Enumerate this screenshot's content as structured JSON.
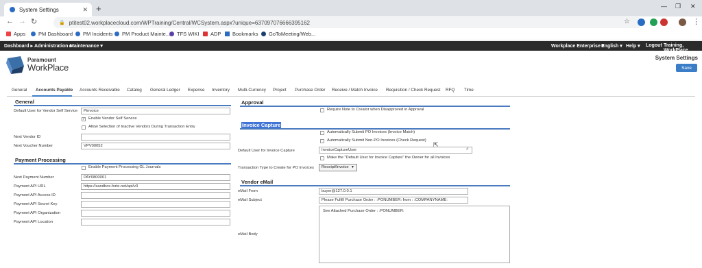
{
  "browser": {
    "tab_title": "System Settings",
    "url": "ptitest02.workplacecloud.com/WPTraining/Central/WCSystem.aspx?unique=637097076666395162"
  },
  "bookmarks": [
    "Apps",
    "PM Dashboard",
    "PM Incidents",
    "PM Product Mainte...",
    "TFS WIKI",
    "ADP",
    "Bookmarks",
    "GoToMeeting/Web..."
  ],
  "appnav": {
    "left": [
      "Dashboard ▸",
      "Administration ▸",
      "Maintenance ▾"
    ],
    "right": [
      "Workplace Enterprise ▾",
      "English ▾",
      "Help ▾",
      "Logout",
      "Training, WorkPlace"
    ]
  },
  "header": {
    "logo_line1": "Paramount",
    "logo_line2": "WorkPlace",
    "page_title": "System Settings",
    "save_label": "Save"
  },
  "tabs": [
    "General",
    "Accounts Payable",
    "Accounts Receivable",
    "Catalog",
    "General Ledger",
    "Expense",
    "Inventory",
    "Multi-Currency",
    "Project",
    "Purchase Order",
    "Receive / Match Invoice",
    "Requisition / Check Request",
    "RFQ",
    "Time"
  ],
  "general": {
    "title": "General",
    "default_user_label": "Default User for Vendor Self Service",
    "default_user_value": "Pinvoice",
    "enable_vss_label": "Enable Vendor Self Service",
    "allow_inactive_label": "Allow Selection of Inactive Vendors During Transaction Entry",
    "next_vendor_label": "Next Vendor ID",
    "next_vendor_value": "",
    "next_voucher_label": "Next Voucher Number",
    "next_voucher_value": "VPV00052"
  },
  "payment": {
    "title": "Payment Processing",
    "enable_gl_label": "Enable Payment Processing GL Journals",
    "next_payment_label": "Next Payment Number",
    "next_payment_value": "PAY0800001",
    "api_url_label": "Payment API URL",
    "api_url_value": "https://sandbox.forte.net/api/v3",
    "access_id_label": "Payment API Access ID",
    "secret_key_label": "Payment API Secret Key",
    "org_label": "Payment API Organization",
    "location_label": "Payment API Location"
  },
  "approval": {
    "title": "Approval",
    "require_note_label": "Require Note to Creator when Disapproved in Approval"
  },
  "invoice_capture": {
    "title": "Invoice Capture",
    "auto_po_label": "Automatically Submit PO Invoices (Invoice Match)",
    "auto_nonpo_label": "Automatically Submit Non-PO Invoices (Check Request)",
    "default_user_label": "Default User for Invoice Capture",
    "default_user_value": "InvoiceCaptureUser",
    "make_owner_label": "Make the \"Default User for Invoice Capture\" the Owner for all Invoices",
    "txn_type_label": "Transaction Type to Create for PO Invoices",
    "txn_type_value": "Receipt/Invoice"
  },
  "vendor_email": {
    "title": "Vendor eMail",
    "from_label": "eMail From",
    "from_value": "buyer@127.0.0.1",
    "subject_label": "eMail Subject",
    "subject_value": "Please Fulfill Purchase Order : :PONUMBER: from : :COMPANYNAME:",
    "body_label": "eMail Body",
    "body_value": "See Attached Purchase Order : :PONUMBER:"
  }
}
